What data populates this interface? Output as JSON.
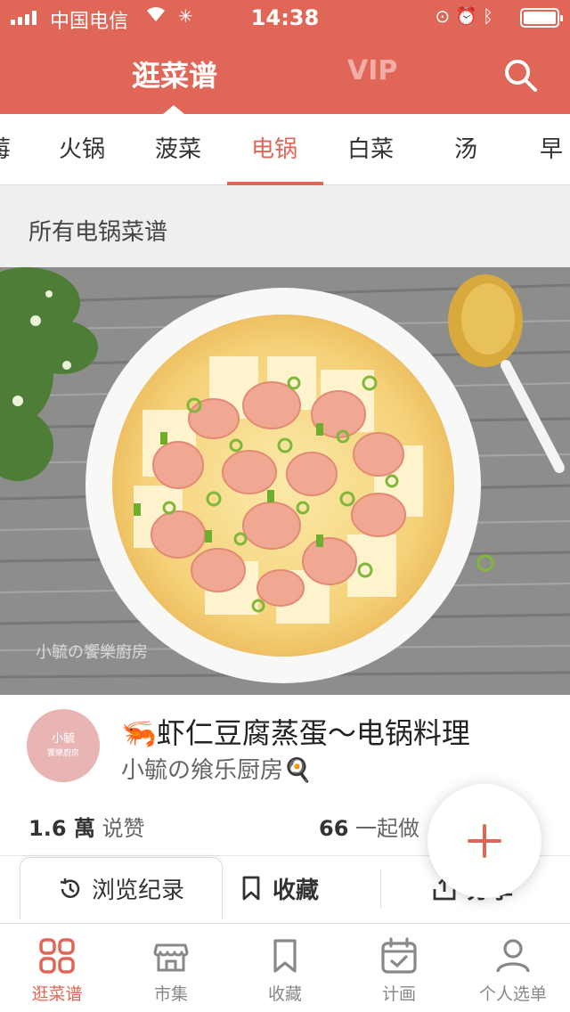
{
  "status_bar": {
    "carrier": "中国电信",
    "time": "14:38",
    "icons": [
      "signal-icon",
      "wifi-icon",
      "loading-icon",
      "rotation-lock-icon",
      "alarm-icon",
      "bluetooth-icon",
      "battery-icon"
    ]
  },
  "header": {
    "title": "逛菜谱",
    "vip": "VIP",
    "search_icon": "search-icon"
  },
  "category_tabs": [
    {
      "label": "莓",
      "active": false
    },
    {
      "label": "火锅",
      "active": false
    },
    {
      "label": "菠菜",
      "active": false
    },
    {
      "label": "电锅",
      "active": true
    },
    {
      "label": "白菜",
      "active": false
    },
    {
      "label": "汤",
      "active": false
    },
    {
      "label": "早餐",
      "active": false
    }
  ],
  "section": {
    "title": "所有电锅菜谱"
  },
  "recipe": {
    "title": "🦐虾仁豆腐蒸蛋～电锅料理",
    "author": "小毓の飨乐厨房🍳",
    "avatar_line1": "小毓",
    "avatar_line2": "饗樂廚房",
    "photo_watermark": "小毓の饗樂廚房",
    "likes_count": "1.6 萬",
    "likes_label": "说赞",
    "cook_count": "66",
    "cook_label": "一起做"
  },
  "actions": {
    "history": "浏览纪录",
    "collect": "收藏",
    "share": "分享"
  },
  "fab_icon": "plus-icon",
  "tabbar": [
    {
      "label": "逛菜谱",
      "icon": "grid-icon",
      "active": true
    },
    {
      "label": "市集",
      "icon": "store-icon",
      "active": false
    },
    {
      "label": "收藏",
      "icon": "bookmark-icon",
      "active": false
    },
    {
      "label": "计画",
      "icon": "calendar-icon",
      "active": false
    },
    {
      "label": "个人选单",
      "icon": "person-icon",
      "active": false
    }
  ],
  "colors": {
    "accent": "#e06757",
    "section_bg": "#efefed"
  }
}
